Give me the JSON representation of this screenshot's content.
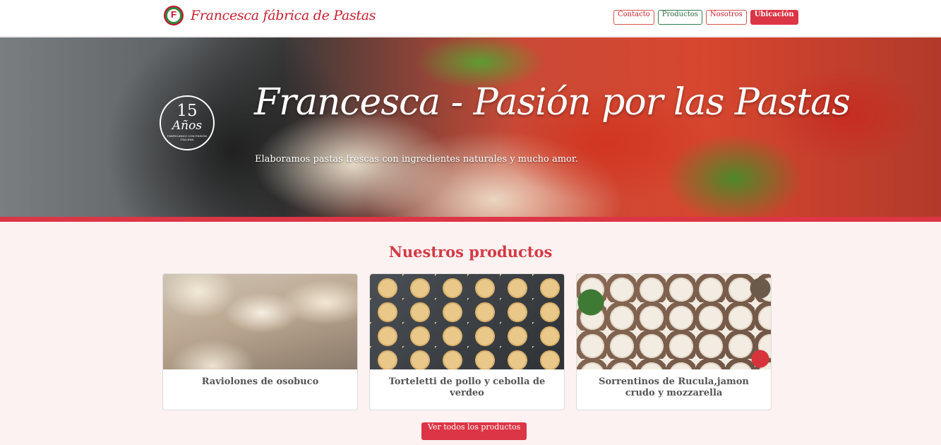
{
  "header": {
    "logo_letter": "F",
    "brand_name": "Francesca fábrica de Pastas",
    "nav": [
      {
        "label": "Contacto",
        "style": "outline-red"
      },
      {
        "label": "Productos",
        "style": "outline-green"
      },
      {
        "label": "Nosotros",
        "style": "outline-red"
      },
      {
        "label": "Ubicación",
        "style": "filled-red"
      }
    ]
  },
  "hero": {
    "badge_number": "15",
    "badge_word": "Años",
    "badge_small": "FABRICANDO CON PASIÓN ITALIANA",
    "title": "Francesca - Pasión por las Pastas",
    "subtitle": "Elaboramos pastas frescas con ingredientes naturales y mucho amor."
  },
  "products": {
    "title": "Nuestros productos",
    "items": [
      {
        "name": "Raviolones de osobuco"
      },
      {
        "name": "Torteletti de pollo y cebolla de verdeo"
      },
      {
        "name": "Sorrentinos de Rucula,jamon crudo y mozzarella"
      }
    ],
    "cta": "Ver todos los productos"
  },
  "colors": {
    "accent": "#dc3545",
    "brand_green": "#2e7d4f",
    "section_bg": "#fdf2f2"
  }
}
